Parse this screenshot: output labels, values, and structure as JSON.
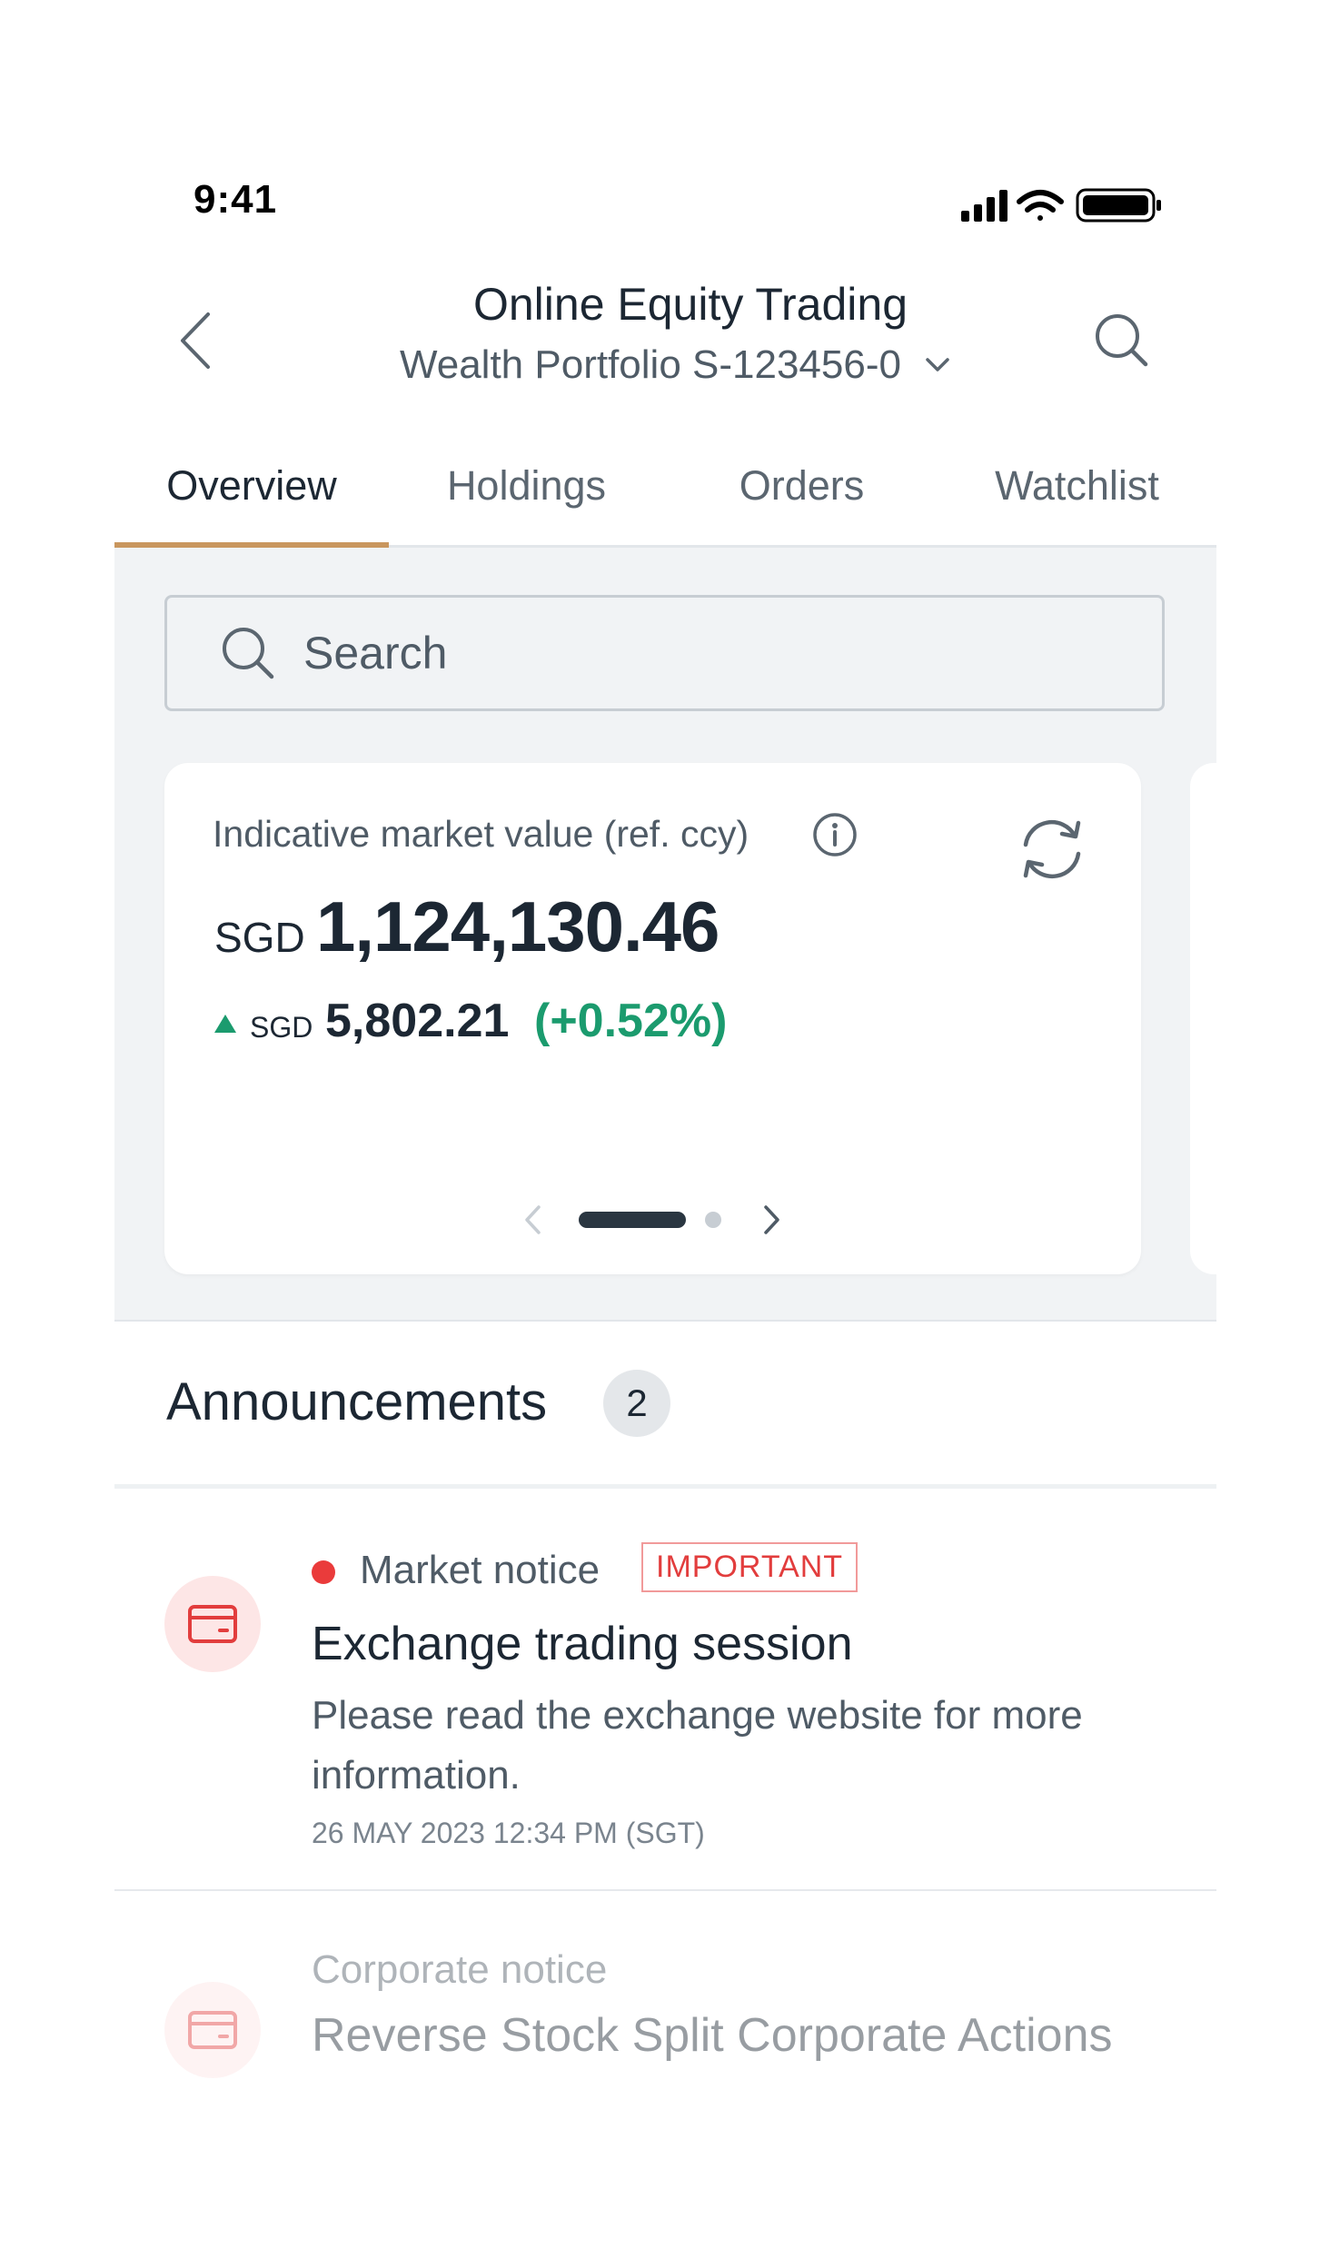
{
  "status_bar": {
    "time": "9:41"
  },
  "header": {
    "title": "Online Equity Trading",
    "subtitle": "Wealth Portfolio S-123456-0"
  },
  "tabs": [
    {
      "label": "Overview",
      "active": true
    },
    {
      "label": "Holdings",
      "active": false
    },
    {
      "label": "Orders",
      "active": false
    },
    {
      "label": "Watchlist",
      "active": false
    }
  ],
  "search": {
    "placeholder": "Search"
  },
  "market_card": {
    "label": "Indicative market value (ref. ccy)",
    "currency": "SGD",
    "value": "1,124,130.46",
    "change_currency": "SGD",
    "change_value": "5,802.21",
    "change_percent": "(+0.52%)",
    "change_color": "#1b9b6e",
    "page_current": 1,
    "page_total": 2
  },
  "announcements": {
    "title": "Announcements",
    "count": "2",
    "items": [
      {
        "category": "Market notice",
        "badge": "IMPORTANT",
        "headline": "Exchange trading session",
        "body": "Please read the exchange website for more information.",
        "date": "26 MAY 2023 12:34 PM (SGT)",
        "unread": true
      },
      {
        "category": "Corporate notice",
        "headline": "Reverse Stock Split Corporate Actions",
        "unread": false
      }
    ]
  },
  "colors": {
    "accent": "#c9965e",
    "positive": "#1b9b6e",
    "alert": "#ea3b3b"
  },
  "icons": [
    "back-chevron-icon",
    "search-icon",
    "chevron-down-icon",
    "info-icon",
    "refresh-icon",
    "card-icon"
  ]
}
